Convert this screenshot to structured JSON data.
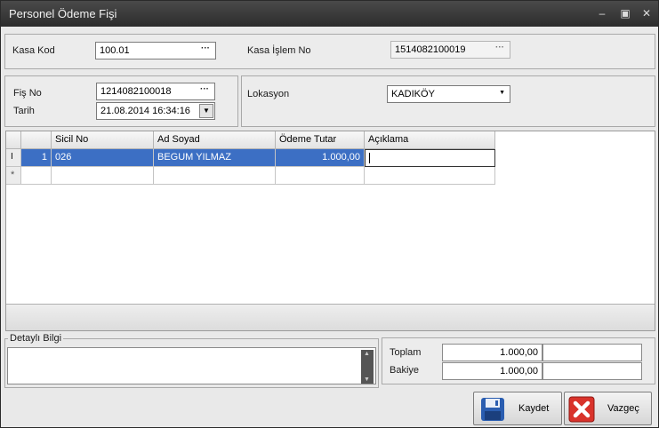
{
  "window": {
    "title": "Personel Ödeme Fişi",
    "controls": [
      "minimize",
      "maximize",
      "close"
    ]
  },
  "header": {
    "kasa_kod_label": "Kasa Kod",
    "kasa_kod_value": "100.01",
    "kasa_islem_label": "Kasa İşlem No",
    "kasa_islem_value": "1514082100019"
  },
  "fis": {
    "fis_no_label": "Fiş No",
    "fis_no_value": "1214082100018",
    "tarih_label": "Tarih",
    "tarih_value": "21.08.2014 16:34:16",
    "lokasyon_label": "Lokasyon",
    "lokasyon_value": "KADIKÖY"
  },
  "grid": {
    "columns": [
      "",
      "Sicil No",
      "Ad Soyad",
      "Ödeme Tutar",
      "Açıklama"
    ],
    "rows": [
      {
        "indicator": "I",
        "row_no": "1",
        "sicil_no": "026",
        "ad_soyad": "BEGUM  YILMAZ",
        "odeme_tutar": "1.000,00",
        "aciklama": ""
      }
    ],
    "new_row_indicator": "*"
  },
  "detay": {
    "label": "Detaylı Bilgi",
    "value": ""
  },
  "totals": {
    "toplam_label": "Toplam",
    "toplam_value": "1.000,00",
    "bakiye_label": "Bakiye",
    "bakiye_value": "1.000,00"
  },
  "buttons": {
    "save_label": "Kaydet",
    "cancel_label": "Vazgeç"
  },
  "colors": {
    "titlebar": "#2f2f2f",
    "selection": "#3c6fc4",
    "cancel_red": "#d9332b",
    "save_blue": "#2a5db0"
  }
}
